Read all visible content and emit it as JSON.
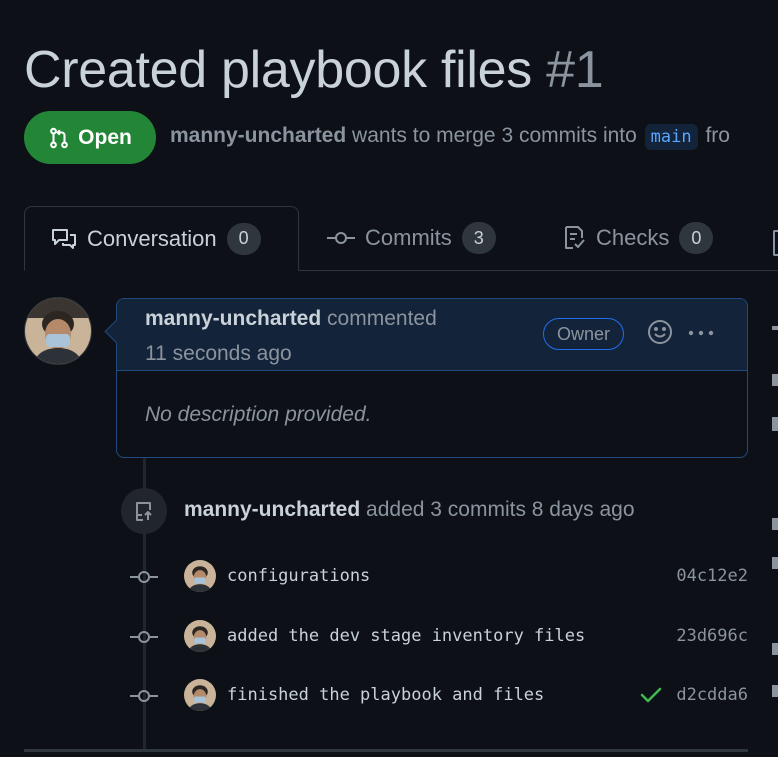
{
  "pr": {
    "title": "Created playbook files",
    "number": "#1",
    "state": "Open",
    "author": "manny-uncharted",
    "merge_text": "wants to merge 3 commits into",
    "base_branch": "main",
    "from_text": "fro"
  },
  "tabs": [
    {
      "label": "Conversation",
      "count": "0",
      "icon": "comment-discussion-icon"
    },
    {
      "label": "Commits",
      "count": "3",
      "icon": "git-commit-icon"
    },
    {
      "label": "Checks",
      "count": "0",
      "icon": "checklist-icon"
    }
  ],
  "comment": {
    "author": "manny-uncharted",
    "action": "commented",
    "time": "11 seconds ago",
    "role": "Owner",
    "body": "No description provided."
  },
  "push_event": {
    "author": "manny-uncharted",
    "text": "added 3 commits 8 days ago"
  },
  "commits": [
    {
      "message": "configurations",
      "sha": "04c12e2",
      "verified": false
    },
    {
      "message": "added the dev stage inventory files",
      "sha": "23d696c",
      "verified": false
    },
    {
      "message": "finished the playbook and files",
      "sha": "d2cdda6",
      "verified": true
    }
  ],
  "colors": {
    "background": "#0d1117",
    "open_badge": "#238636",
    "accent_blue": "#58a6ff",
    "success_check": "#3fb950"
  }
}
